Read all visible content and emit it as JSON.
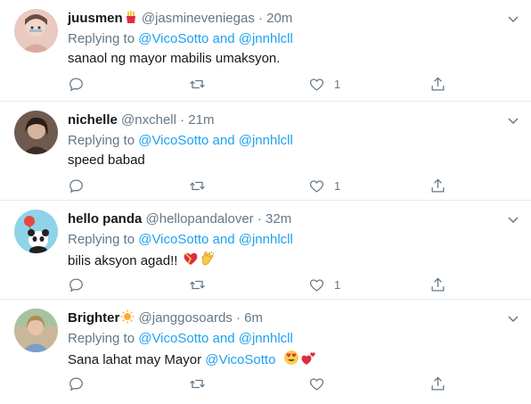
{
  "colors": {
    "link": "#1da1f2",
    "muted": "#657786",
    "text": "#14171a",
    "divider": "#e6ecf0"
  },
  "tweets": [
    {
      "name": "juusmen",
      "name_emoji": "fries-emoji",
      "handle": "@jasmineveniegas",
      "separator": "·",
      "time": "20m",
      "replying_prefix": "Replying to",
      "replying_users": "@VicoSotto and @jnnhlcll",
      "text": "sanaol ng mayor mabilis umaksyon.",
      "like_count": "1"
    },
    {
      "name": "nichelle",
      "handle": "@nxchell",
      "separator": "·",
      "time": "21m",
      "replying_prefix": "Replying to",
      "replying_users": "@VicoSotto and @jnnhlcll",
      "text": "speed babad",
      "like_count": "1"
    },
    {
      "name": "hello panda",
      "handle": "@hellopandalover",
      "separator": "·",
      "time": "32m",
      "replying_prefix": "Replying to",
      "replying_users": "@VicoSotto and @jnnhlcll",
      "text": "bilis aksyon agad!!",
      "text_emojis": [
        "heart-ribbon-emoji",
        "clapping-hands-emoji"
      ],
      "like_count": "1"
    },
    {
      "name": "Brighter",
      "name_emoji": "sun-emoji",
      "handle": "@janggosoards",
      "separator": "·",
      "time": "6m",
      "replying_prefix": "Replying to",
      "replying_users": "@VicoSotto and @jnnhlcll",
      "text_prefix": "Sana lahat may Mayor ",
      "text_mention": "@VicoSotto",
      "text_emojis": [
        "heart-eyes-emoji",
        "two-hearts-emoji"
      ]
    }
  ]
}
